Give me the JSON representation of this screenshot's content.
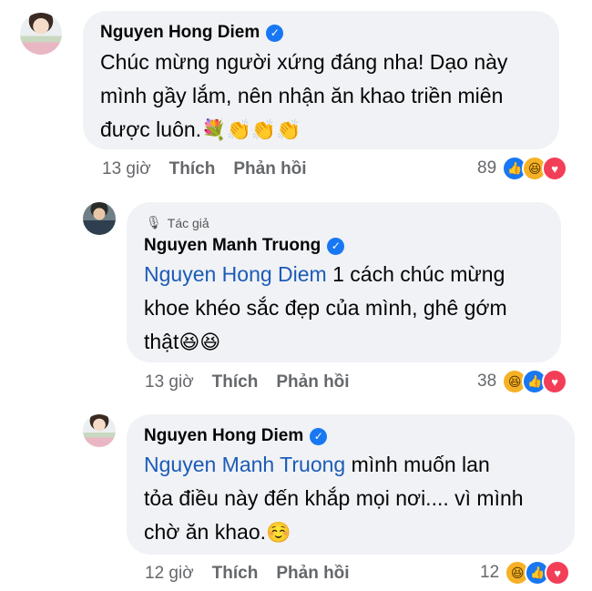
{
  "comments": [
    {
      "author": "Nguyen Hong Diem",
      "verified_glyph": "✓",
      "text_line1": "Chúc mừng người xứng đáng nha! Dạo này",
      "text_line2": "mình gầy lắm, nên nhận ăn khao triền miên",
      "text_line3": "được luôn.",
      "emojis": "💐👏👏👏",
      "time": "13 giờ",
      "like_label": "Thích",
      "reply_label": "Phản hồi",
      "reaction_count": "89",
      "reactions": [
        "like",
        "haha",
        "love"
      ]
    },
    {
      "author_tag": "Tác giả",
      "author": "Nguyen Manh Truong",
      "verified_glyph": "✓",
      "mention": "Nguyen Hong Diem",
      "text_line1_rest": " 1 cách chúc mừng",
      "text_line2": "khoe khéo sắc đẹp của mình, ghê gớm",
      "text_line3": "thật",
      "emojis": "😆😆",
      "time": "13 giờ",
      "like_label": "Thích",
      "reply_label": "Phản hồi",
      "reaction_count": "38",
      "reactions": [
        "haha",
        "like",
        "love"
      ]
    },
    {
      "author": "Nguyen Hong Diem",
      "verified_glyph": "✓",
      "mention": "Nguyen Manh Truong",
      "text_line1_rest": " mình muốn lan",
      "text_line2": "tỏa điều này đến khắp mọi nơi.... vì mình",
      "text_line3": "chờ ăn khao.",
      "emojis": "☺️",
      "time": "12 giờ",
      "like_label": "Thích",
      "reply_label": "Phản hồi",
      "reaction_count": "12",
      "reactions": [
        "haha",
        "like",
        "love"
      ]
    }
  ],
  "icons": {
    "mic": "🎙",
    "like": "👍",
    "haha": "😆",
    "love": "♥"
  },
  "colors": {
    "bubble": "#f0f2f5",
    "mention": "#1c5bb7",
    "verified": "#1877f2",
    "love": "#f33e58",
    "haha": "#f7b125"
  }
}
